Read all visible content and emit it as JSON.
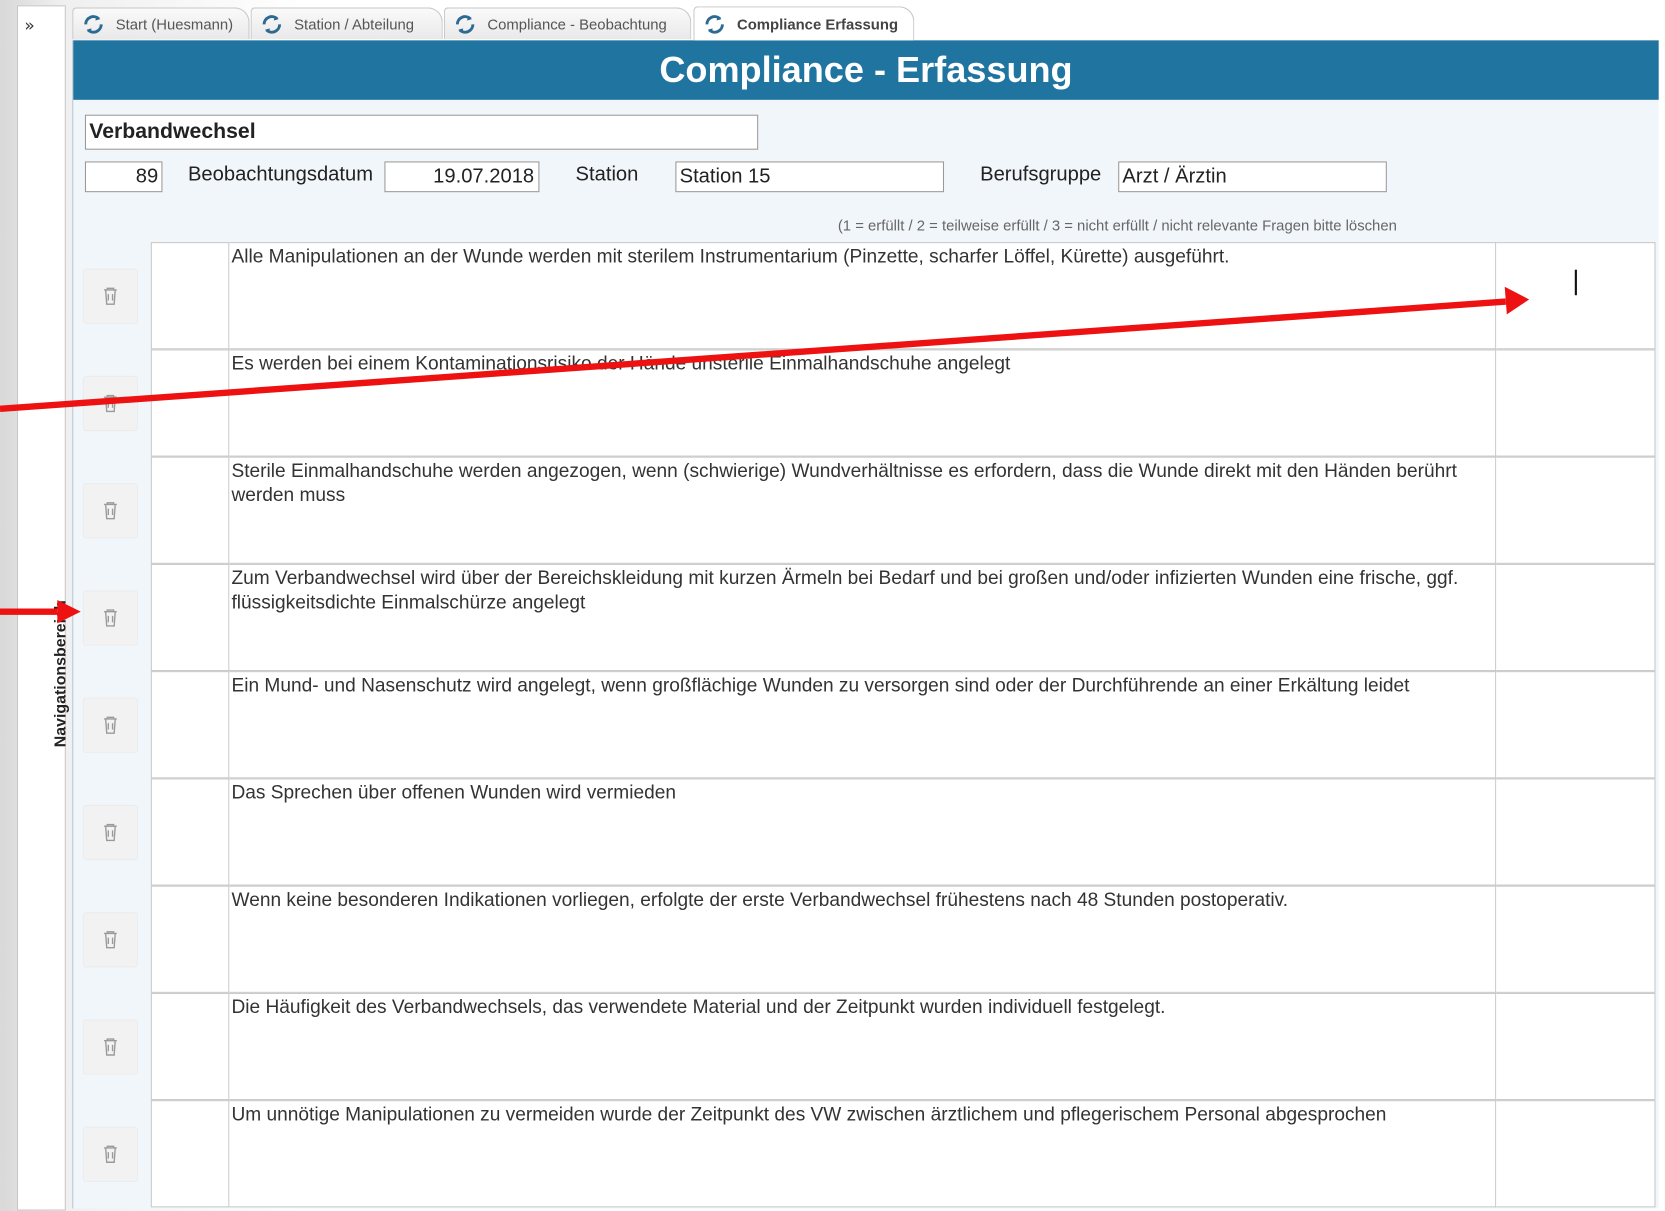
{
  "nav": {
    "toggle": "»",
    "label": "Navigationsbereich"
  },
  "tabs": [
    {
      "label": "Start (Huesmann)"
    },
    {
      "label": "Station / Abteilung"
    },
    {
      "label": "Compliance - Beobachtung"
    },
    {
      "label": "Compliance Erfassung"
    }
  ],
  "form": {
    "title": "Compliance - Erfassung",
    "topic": "Verbandwechsel",
    "id_value": "89",
    "date_label": "Beobachtungsdatum",
    "date_value": "19.07.2018",
    "station_label": "Station",
    "station_value": "Station 15",
    "group_label": "Berufsgruppe",
    "group_value": "Arzt / Ärztin",
    "legend": "(1 = erfüllt  / 2 = teilweise erfüllt / 3 = nicht erfüllt / nicht relevante Fragen bitte löschen"
  },
  "questions": [
    "Alle Manipulationen an der Wunde werden mit sterilem Instrumentarium (Pinzette, scharfer Löffel, Kürette) ausgeführt.",
    "Es werden bei einem Kontaminationsrisiko der Hände unsterile Einmalhandschuhe angelegt",
    "Sterile Einmalhandschuhe werden angezogen, wenn (schwierige) Wundverhältnisse es erfordern, dass die Wunde direkt mit den Händen berührt werden muss",
    "Zum Verbandwechsel wird über der Bereichskleidung mit kurzen Ärmeln bei Bedarf und bei großen und/oder infizierten Wunden eine frische, ggf. flüssigkeitsdichte Einmalschürze angelegt",
    "Ein Mund- und Nasenschutz wird angelegt, wenn großflächige Wunden zu versorgen sind oder der Durchführende an einer Erkältung leidet",
    "Das Sprechen über offenen Wunden wird vermieden",
    "Wenn keine besonderen Indikationen vorliegen, erfolgte der erste Verbandwechsel frühestens nach 48 Stunden postoperativ.",
    "Die Häufigkeit des Verbandwechsels, das verwendete Material und der Zeitpunkt wurden individuell festgelegt.",
    "Um unnötige Manipulationen zu vermeiden wurde der Zeitpunkt des VW zwischen ärztlichem und pflegerischem Personal abgesprochen"
  ],
  "icons": {
    "tab": "refresh-icon",
    "delete": "trash-icon"
  },
  "colors": {
    "header": "#2074a0",
    "arrow": "#ee1111"
  }
}
